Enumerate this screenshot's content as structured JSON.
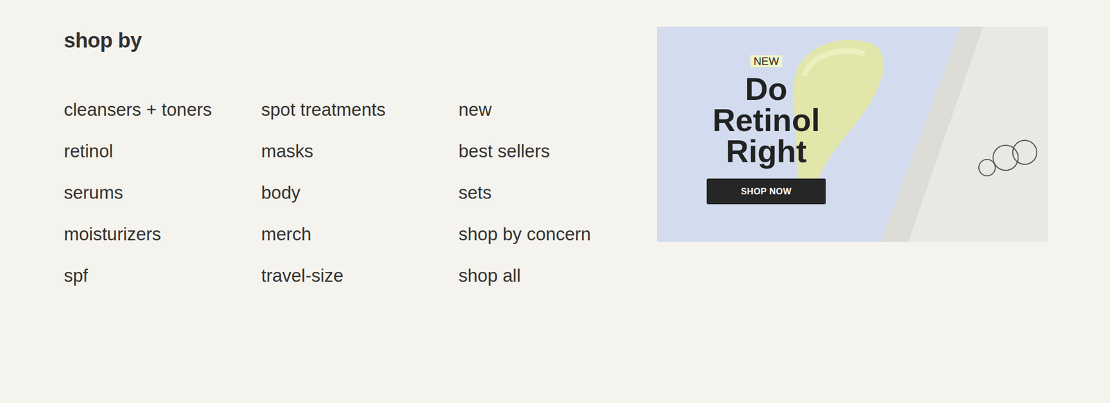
{
  "heading": "shop by",
  "columns": [
    [
      {
        "label": "cleansers + toners"
      },
      {
        "label": "retinol"
      },
      {
        "label": "serums"
      },
      {
        "label": "moisturizers"
      },
      {
        "label": "spf"
      }
    ],
    [
      {
        "label": "spot treatments"
      },
      {
        "label": "masks"
      },
      {
        "label": "body"
      },
      {
        "label": "merch"
      },
      {
        "label": "travel-size"
      }
    ],
    [
      {
        "label": "new"
      },
      {
        "label": "best sellers"
      },
      {
        "label": "sets"
      },
      {
        "label": "shop by concern"
      },
      {
        "label": "shop all"
      }
    ]
  ],
  "banner": {
    "badge": "NEW",
    "title": "Do Retinol Right",
    "button": "SHOP NOW"
  }
}
